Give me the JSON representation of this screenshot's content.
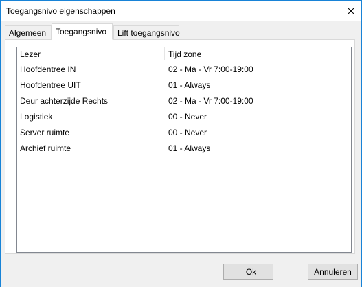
{
  "window": {
    "title": "Toegangsnivo eigenschappen"
  },
  "tabs": [
    {
      "label": "Algemeen",
      "active": false
    },
    {
      "label": "Toegangsnivo",
      "active": true
    },
    {
      "label": "Lift toegangsnivo",
      "active": false
    }
  ],
  "list": {
    "columns": [
      "Lezer",
      "Tijd zone"
    ],
    "rows": [
      {
        "lezer": "Hoofdentree IN",
        "tijdzone": "02 - Ma - Vr 7:00-19:00"
      },
      {
        "lezer": "Hoofdentree UIT",
        "tijdzone": "01 - Always"
      },
      {
        "lezer": "Deur achterzijde Rechts",
        "tijdzone": "02 - Ma - Vr 7:00-19:00"
      },
      {
        "lezer": "Logistiek",
        "tijdzone": "00 - Never"
      },
      {
        "lezer": "Server ruimte",
        "tijdzone": "00 - Never"
      },
      {
        "lezer": "Archief ruimte",
        "tijdzone": "01 - Always"
      }
    ]
  },
  "buttons": {
    "ok": "Ok",
    "cancel": "Annuleren"
  },
  "icons": {
    "close": "close-icon"
  }
}
